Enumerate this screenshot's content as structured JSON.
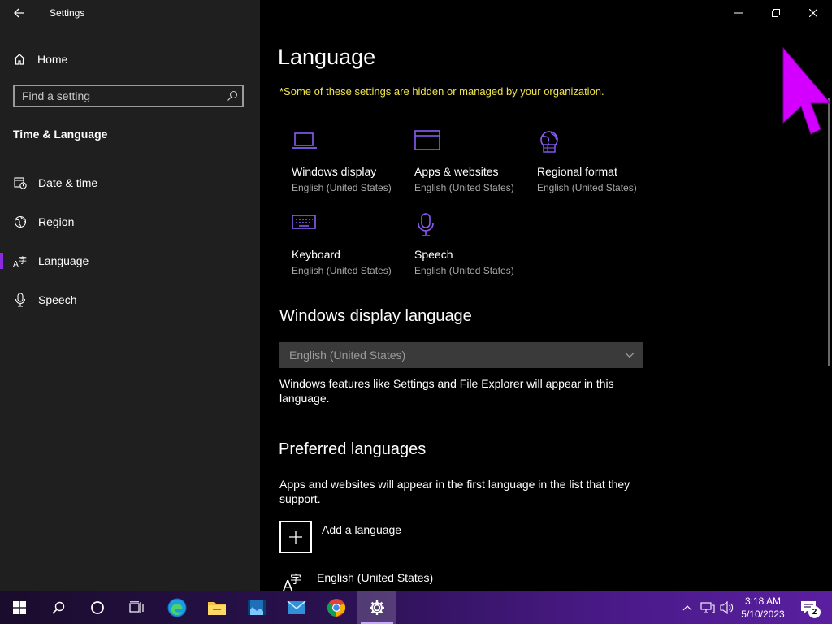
{
  "app": {
    "title": "Settings"
  },
  "sidebar": {
    "home_label": "Home",
    "search_placeholder": "Find a setting",
    "section_title": "Time & Language",
    "items": [
      {
        "label": "Date & time",
        "icon": "calendar-clock-icon"
      },
      {
        "label": "Region",
        "icon": "globe-icon"
      },
      {
        "label": "Language",
        "icon": "language-icon",
        "selected": true
      },
      {
        "label": "Speech",
        "icon": "microphone-icon"
      }
    ]
  },
  "main": {
    "title": "Language",
    "org_note": "*Some of these settings are hidden or managed by your organization.",
    "tiles": [
      {
        "title": "Windows display",
        "subtitle": "English (United States)",
        "icon": "laptop-icon"
      },
      {
        "title": "Apps & websites",
        "subtitle": "English (United States)",
        "icon": "browser-window-icon"
      },
      {
        "title": "Regional format",
        "subtitle": "English (United States)",
        "icon": "regional-format-icon"
      },
      {
        "title": "Keyboard",
        "subtitle": "English (United States)",
        "icon": "keyboard-icon"
      },
      {
        "title": "Speech",
        "subtitle": "English (United States)",
        "icon": "microphone-icon"
      }
    ],
    "display_language": {
      "heading": "Windows display language",
      "selected": "English (United States)",
      "description": "Windows features like Settings and File Explorer will appear in this language."
    },
    "preferred": {
      "heading": "Preferred languages",
      "description": "Apps and websites will appear in the first language in the list that they support.",
      "add_label": "Add a language",
      "languages": [
        {
          "label": "English (United States)"
        }
      ]
    }
  },
  "taskbar": {
    "apps": [
      "start-icon",
      "search-icon",
      "cortana-icon",
      "task-view-icon",
      "edge-icon",
      "file-explorer-icon",
      "photos-icon",
      "mail-icon",
      "chrome-icon",
      "settings-icon"
    ],
    "time": "3:18 AM",
    "date": "5/10/2023",
    "notification_count": "2"
  },
  "colors": {
    "accent": "#8a2be2",
    "accent_light": "#9b5cf5",
    "warning_text": "#f0e54c",
    "sidebar_bg": "#1f1f1f",
    "cursor": "#d400ff"
  }
}
